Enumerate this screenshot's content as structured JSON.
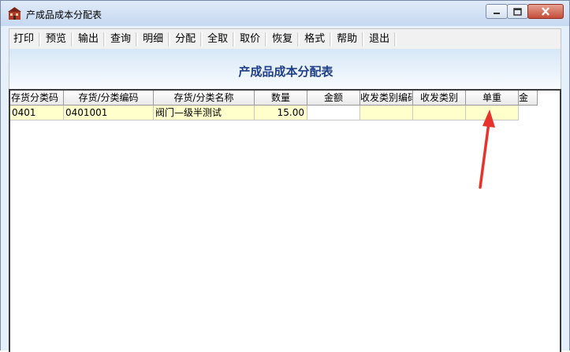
{
  "window": {
    "title": "产成品成本分配表"
  },
  "toolbar": {
    "buttons": [
      "打印",
      "预览",
      "输出",
      "查询",
      "明细",
      "分配",
      "全取",
      "取价",
      "恢复",
      "格式",
      "帮助",
      "退出"
    ]
  },
  "report": {
    "title": "产成品成本分配表"
  },
  "table": {
    "columns": [
      "存货分类码",
      "存货/分类编码",
      "存货/分类名称",
      "数量",
      "金额",
      "收发类别编码",
      "收发类别",
      "单重",
      "金"
    ],
    "rows": [
      {
        "class_code": "0401",
        "item_code": "0401001",
        "item_name": "阀门—级半测试",
        "quantity": "15.00",
        "amount": "",
        "type_code": "",
        "type_name": "",
        "unit_weight": ""
      }
    ]
  },
  "annotation": {
    "arrow_color": "#e8322c",
    "target": "单重"
  },
  "colors": {
    "titlebar": "#c6d9f1",
    "report_title": "#1f3f89",
    "row_fill": "#ffffcc",
    "close_button": "#c44c3a"
  }
}
